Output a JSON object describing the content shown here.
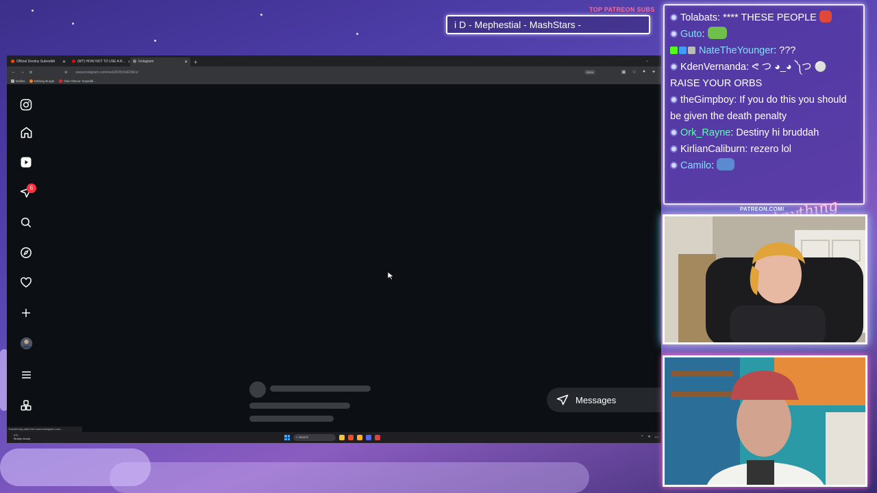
{
  "overlay": {
    "patreon_label": "TOP PATREON SUBS",
    "patreon_ticker": "i D - Mephestial - MashStars -",
    "patreon_url": "PATREON.COM/",
    "logo_text": "Anything Else?"
  },
  "browser": {
    "tabs": [
      {
        "title": "Official Destiny Subreddit",
        "color": "#ff4500",
        "active": false
      },
      {
        "title": "(WT) HOW NOT TO USE A R…",
        "color": "#ff0000",
        "active": false
      },
      {
        "title": "Instagram",
        "color": "#888888",
        "active": true
      }
    ],
    "new_tab": "+",
    "url": "www.instagram.com/reels/DXfsTeEDbFo/",
    "zoom": "200%",
    "bookmarks": [
      {
        "label": "Dailies",
        "color": "#aaaaaa"
      },
      {
        "label": "Nothing Burger",
        "color": "#ff7a1a"
      },
      {
        "label": "Clair Obscur: Expediti…",
        "color": "#d62f2f"
      }
    ],
    "status_text": "Transferring data from www.instagram.com..."
  },
  "instagram": {
    "notification_count": "6",
    "sidebar_icons": [
      "instagram-logo-icon",
      "home-icon",
      "reels-icon",
      "messages-icon",
      "search-icon",
      "explore-icon",
      "heart-icon",
      "create-icon",
      "profile-avatar",
      "menu-icon",
      "apps-icon"
    ],
    "messages_label": "Messages"
  },
  "taskbar": {
    "weather_temp": "4°C",
    "weather_desc": "Mostly cloudy",
    "search_label": "Search"
  },
  "chat": {
    "messages": [
      {
        "user": "Tolabats",
        "color": "#ffffff",
        "text": "**** THESE PEOPLE",
        "emote": "#e0483a"
      },
      {
        "user": "Guto",
        "color": "#7fe0ff",
        "text": "",
        "emote": "#6fbf4a"
      },
      {
        "user": "NateTheYounger",
        "color": "#7fe0ff",
        "text": "???",
        "emote": ""
      },
      {
        "user": "KdenVernanda",
        "color": "#ffffff",
        "text": "ᕙ つ ◕_◕ ༽つ ⚪ RAISE YOUR ORBS",
        "emote": ""
      },
      {
        "user": "theGimpboy",
        "color": "#ffffff",
        "text": "If you do this you should be given the death penalty",
        "emote": ""
      },
      {
        "user": "Ork_Rayne",
        "color": "#5cffb0",
        "text": "Destiny hi bruddah",
        "emote": ""
      },
      {
        "user": "KirlianCaliburn",
        "color": "#ffffff",
        "text": "rezero lol",
        "emote": ""
      },
      {
        "user": "Camilo",
        "color": "#7fe0ff",
        "text": "",
        "emote": "#5a8ad0"
      }
    ]
  }
}
